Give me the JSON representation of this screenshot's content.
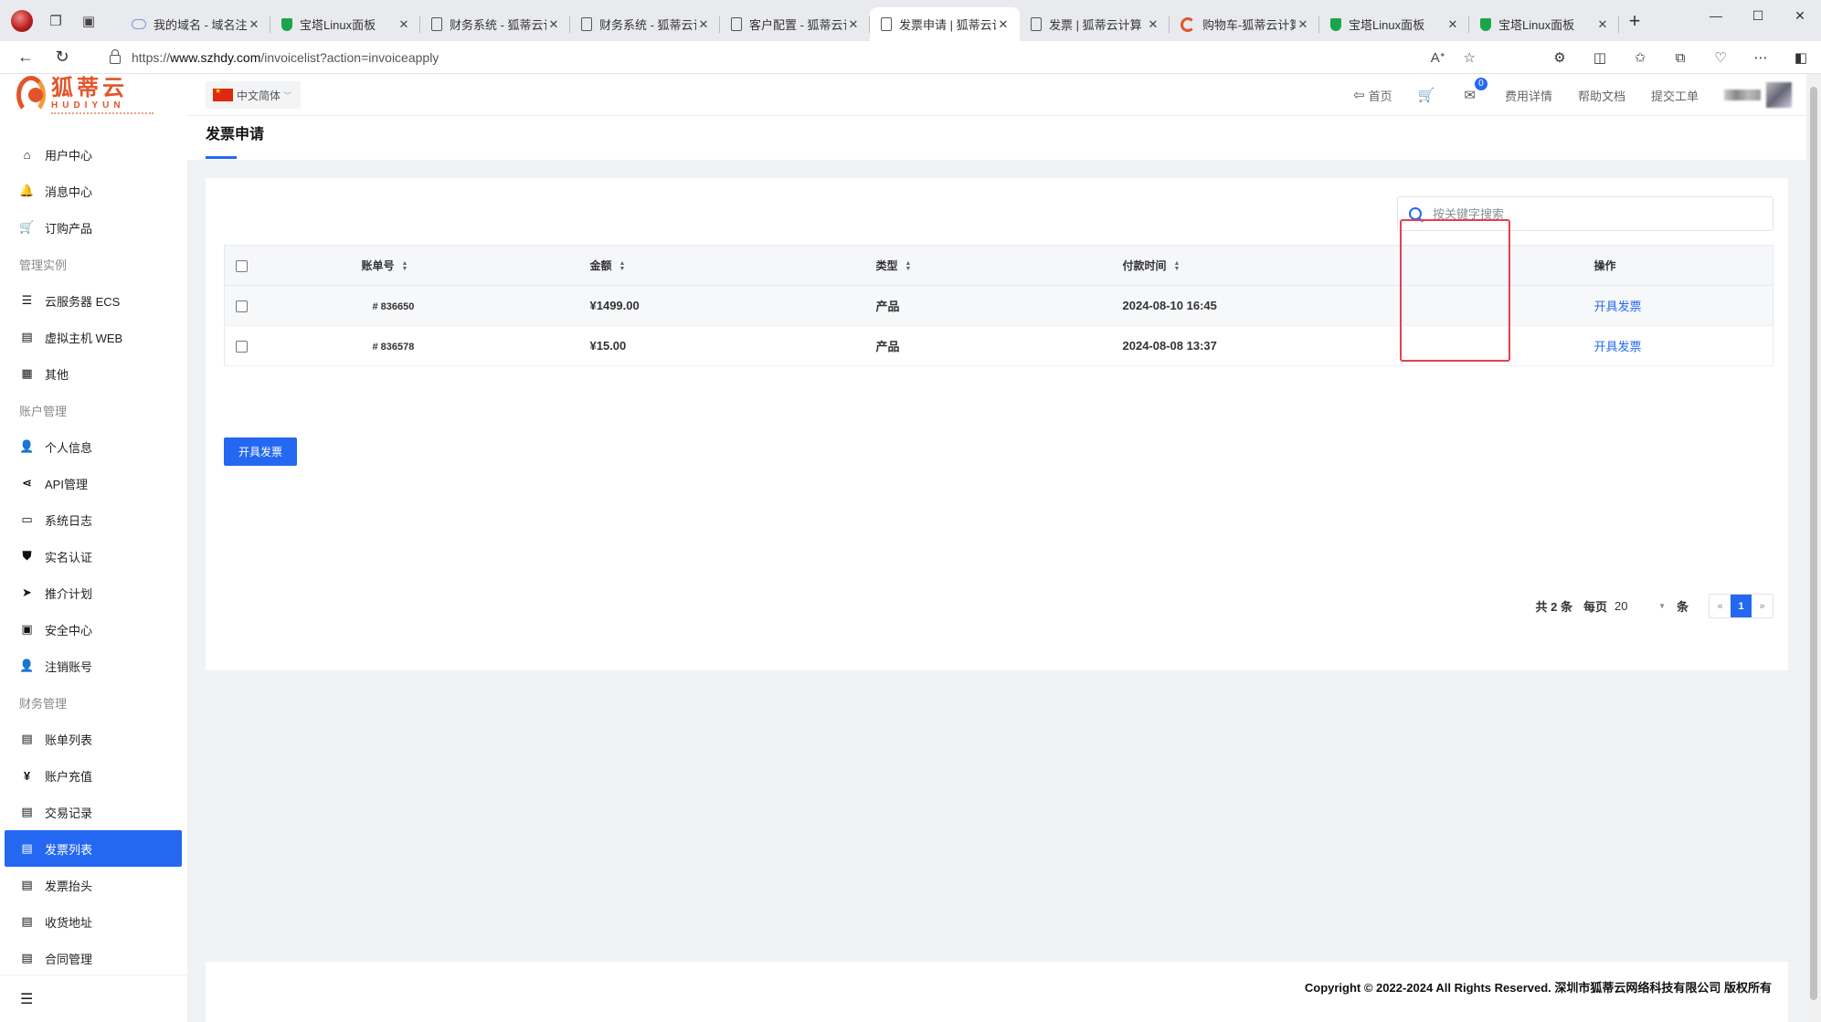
{
  "browser": {
    "tabs": [
      {
        "title": "我的域名 - 域名注册",
        "fav": "cloud"
      },
      {
        "title": "宝塔Linux面板",
        "fav": "shield"
      },
      {
        "title": "财务系统 - 狐蒂云计",
        "fav": "doc"
      },
      {
        "title": "财务系统 - 狐蒂云计",
        "fav": "doc"
      },
      {
        "title": "客户配置 - 狐蒂云计",
        "fav": "doc"
      },
      {
        "title": "发票申请 | 狐蒂云计",
        "fav": "doc"
      },
      {
        "title": "发票 | 狐蒂云计算",
        "fav": "doc"
      },
      {
        "title": "购物车-狐蒂云计算",
        "fav": "fox"
      },
      {
        "title": "宝塔Linux面板",
        "fav": "shield"
      },
      {
        "title": "宝塔Linux面板",
        "fav": "shield"
      }
    ],
    "url_prefix": "https://",
    "url_host": "www.szhdy.com",
    "url_path": "/invoicelist?action=invoiceapply"
  },
  "logo": {
    "cn": "狐蒂云",
    "en": "HUDIYUN"
  },
  "sidebar": {
    "items": [
      {
        "type": "item",
        "label": "用户中心",
        "icon": "home-icon",
        "glyph": "⌂"
      },
      {
        "type": "item",
        "label": "消息中心",
        "icon": "bell-icon",
        "glyph": "🔔"
      },
      {
        "type": "item",
        "label": "订购产品",
        "icon": "cart-icon",
        "glyph": "🛒"
      },
      {
        "type": "group",
        "label": "管理实例"
      },
      {
        "type": "item",
        "label": "云服务器 ECS",
        "icon": "server-icon",
        "glyph": "☰"
      },
      {
        "type": "item",
        "label": "虚拟主机 WEB",
        "icon": "book-icon",
        "glyph": "▤"
      },
      {
        "type": "item",
        "label": "其他",
        "icon": "grid-icon",
        "glyph": "▦"
      },
      {
        "type": "group",
        "label": "账户管理"
      },
      {
        "type": "item",
        "label": "个人信息",
        "icon": "user-icon",
        "glyph": "👤"
      },
      {
        "type": "item",
        "label": "API管理",
        "icon": "share-icon",
        "glyph": "⋖"
      },
      {
        "type": "item",
        "label": "系统日志",
        "icon": "chat-icon",
        "glyph": "▭"
      },
      {
        "type": "item",
        "label": "实名认证",
        "icon": "shield-icon",
        "glyph": "⛊"
      },
      {
        "type": "item",
        "label": "推介计划",
        "icon": "send-icon",
        "glyph": "➤"
      },
      {
        "type": "item",
        "label": "安全中心",
        "icon": "id-card-icon",
        "glyph": "▣"
      },
      {
        "type": "item",
        "label": "注销账号",
        "icon": "user-icon",
        "glyph": "👤"
      },
      {
        "type": "group",
        "label": "财务管理"
      },
      {
        "type": "item",
        "label": "账单列表",
        "icon": "document-icon",
        "glyph": "▤"
      },
      {
        "type": "item",
        "label": "账户充值",
        "icon": "yen-icon",
        "glyph": "¥"
      },
      {
        "type": "item",
        "label": "交易记录",
        "icon": "receipt-icon",
        "glyph": "▤"
      },
      {
        "type": "item",
        "label": "发票列表",
        "icon": "invoice-icon",
        "glyph": "▤",
        "active": true
      },
      {
        "type": "item",
        "label": "发票抬头",
        "icon": "invoice-header-icon",
        "glyph": "▤"
      },
      {
        "type": "item",
        "label": "收货地址",
        "icon": "address-icon",
        "glyph": "▤"
      },
      {
        "type": "item",
        "label": "合同管理",
        "icon": "contract-icon",
        "glyph": "▤"
      }
    ]
  },
  "topnav": {
    "language": "中文简体",
    "home": "首页",
    "mail_count": "0",
    "billing": "费用详情",
    "help": "帮助文档",
    "ticket": "提交工单"
  },
  "page": {
    "title": "发票申请"
  },
  "search": {
    "placeholder": "按关键字搜索"
  },
  "table": {
    "headers": {
      "bill_no": "账单号",
      "amount": "金额",
      "type": "类型",
      "paid_time": "付款时间",
      "action": "操作"
    },
    "rows": [
      {
        "bill_no": "# 836650",
        "amount": "¥1499.00",
        "type": "产品",
        "paid_time": "2024-08-10 16:45",
        "action": "开具发票"
      },
      {
        "bill_no": "# 836578",
        "amount": "¥15.00",
        "type": "产品",
        "paid_time": "2024-08-08 13:37",
        "action": "开具发票"
      }
    ]
  },
  "issue_button": "开具发票",
  "pager": {
    "total": "共 2 条",
    "per_page_label": "每页",
    "per_page": "20",
    "unit": "条",
    "prev": "«",
    "current": "1",
    "next": "»"
  },
  "footer": "Copyright © 2022-2024 All Rights Reserved. 深圳市狐蒂云网络科技有限公司 版权所有",
  "colors": {
    "accent": "#2468f2",
    "highlight_box": "#e5404f",
    "brand": "#e2552b"
  }
}
